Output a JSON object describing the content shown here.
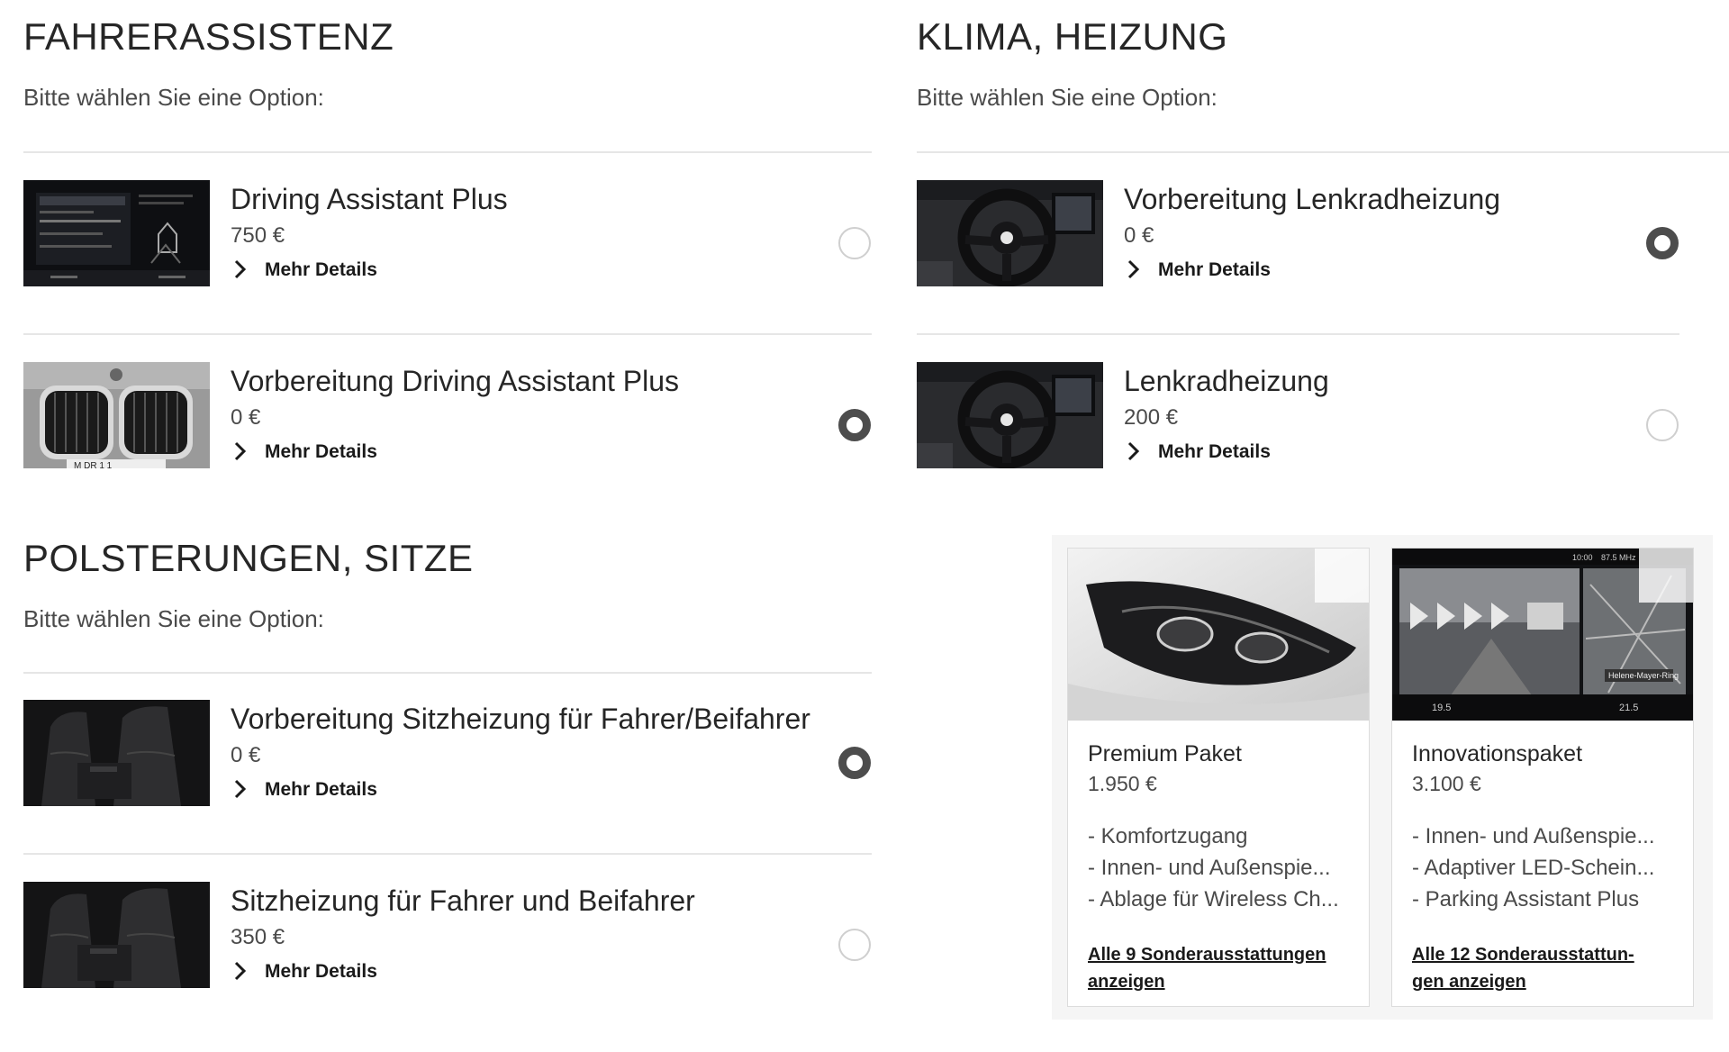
{
  "sections": {
    "fahrerassistenz": {
      "title": "FAHRERASSISTENZ",
      "subtitle": "Bitte wählen Sie eine Option:",
      "options": [
        {
          "name": "Driving Assistant Plus",
          "price": "750 €",
          "details": "Mehr Details",
          "selected": false,
          "image": "driving-assistant-screen-image"
        },
        {
          "name": "Vorbereitung Driving Assistant Plus",
          "price": "0 €",
          "details": "Mehr Details",
          "selected": true,
          "image": "kidney-grille-image"
        }
      ]
    },
    "klima": {
      "title": "KLIMA, HEIZUNG",
      "subtitle": "Bitte wählen Sie eine Option:",
      "options": [
        {
          "name": "Vorbereitung Lenkradheizung",
          "price": "0 €",
          "details": "Mehr Details",
          "selected": true,
          "image": "steering-wheel-image"
        },
        {
          "name": "Lenkradheizung",
          "price": "200 €",
          "details": "Mehr Details",
          "selected": false,
          "image": "steering-wheel-image"
        }
      ]
    },
    "polsterungen": {
      "title": "POLSTERUNGEN, SITZE",
      "subtitle": "Bitte wählen Sie eine Option:",
      "options": [
        {
          "name": "Vorbereitung Sitzheizung für Fahrer/Beifahrer",
          "price": "0 €",
          "details": "Mehr Details",
          "selected": true,
          "image": "seats-image"
        },
        {
          "name": "Sitzheizung für Fahrer und Beifahrer",
          "price": "350 €",
          "details": "Mehr Details",
          "selected": false,
          "image": "seats-image"
        }
      ]
    }
  },
  "packages": [
    {
      "name": "Premium Paket",
      "price": "1.950 €",
      "features": [
        "- Komfortzugang",
        "- Innen- und Außenspie...",
        "- Ablage für Wireless Ch..."
      ],
      "link_line1": "Alle 9 Sonderausstattungen",
      "link_line2": "anzeigen",
      "image": "headlight-image"
    },
    {
      "name": "Innovationspaket",
      "price": "3.100 €",
      "features": [
        "- Innen- und Außenspie...",
        "- Adaptiver LED-Schein...",
        "- Parking Assistant Plus"
      ],
      "link_line1": "Alle 12 Sonderausstattun-",
      "link_line2": "gen anzeigen",
      "image": "navigation-screen-image"
    }
  ],
  "image_texts": {
    "nav_time": "10:00",
    "nav_frequency": "87.5 MHz",
    "nav_street": "Helene-Mayer-Ring",
    "nav_temp_left": "19.5",
    "nav_temp_right": "21.5",
    "grille_plate": "M DR 1 1"
  },
  "colors": {
    "selected_radio": "#4d4d4d",
    "divider": "#e6e6e6",
    "package_background": "#f5f5f5"
  }
}
